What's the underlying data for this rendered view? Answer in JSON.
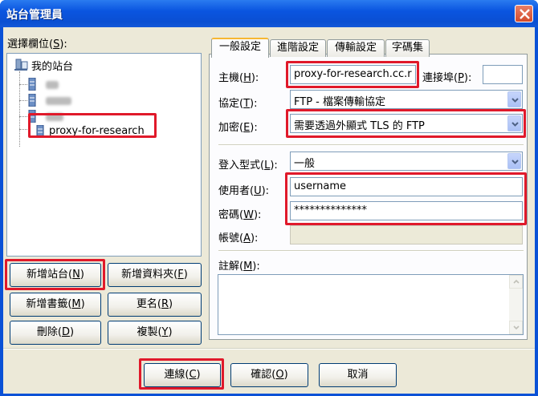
{
  "window": {
    "title": "站台管理員"
  },
  "left": {
    "select_label": "選擇欄位(",
    "select_key": "S",
    "select_end": "):",
    "tree_root": "我的站台",
    "tree_selected": "proxy-for-research"
  },
  "buttons": {
    "new_site": "新增站台(",
    "new_site_key": "N",
    "new_folder": "新增資料夾(",
    "new_folder_key": "F",
    "new_bookmark": "新增書籤(",
    "new_bookmark_key": "M",
    "rename": "更名(",
    "rename_key": "R",
    "delete": "刪除(",
    "delete_key": "D",
    "copy": "複製(",
    "copy_key": "Y",
    "connect": "連線(",
    "connect_key": "C",
    "ok": "確認(",
    "ok_key": "O",
    "cancel": "取消",
    "close_paren": ")"
  },
  "tabs": [
    "一般設定",
    "進階設定",
    "傳輸設定",
    "字碼集"
  ],
  "form": {
    "host_label": "主機(",
    "host_key": "H",
    "host_value": "proxy-for-research.cc.r",
    "port_label": "連接埠(",
    "port_key": "P",
    "port_value": "",
    "protocol_label": "協定(",
    "protocol_key": "T",
    "protocol_value": "FTP - 檔案傳輸協定",
    "encrypt_label": "加密(",
    "encrypt_key": "E",
    "encrypt_value": "需要透過外顯式 TLS 的 FTP",
    "logon_label": "登入型式(",
    "logon_key": "L",
    "logon_value": "一般",
    "user_label": "使用者(",
    "user_key": "U",
    "user_value": "username",
    "password_label": "密碼(",
    "password_key": "W",
    "password_value": "**************",
    "account_label": "帳號(",
    "account_key": "A",
    "account_value": "",
    "comments_label": "註解(",
    "comments_key": "M",
    "comments_end": "):",
    "colon_end": "):"
  }
}
